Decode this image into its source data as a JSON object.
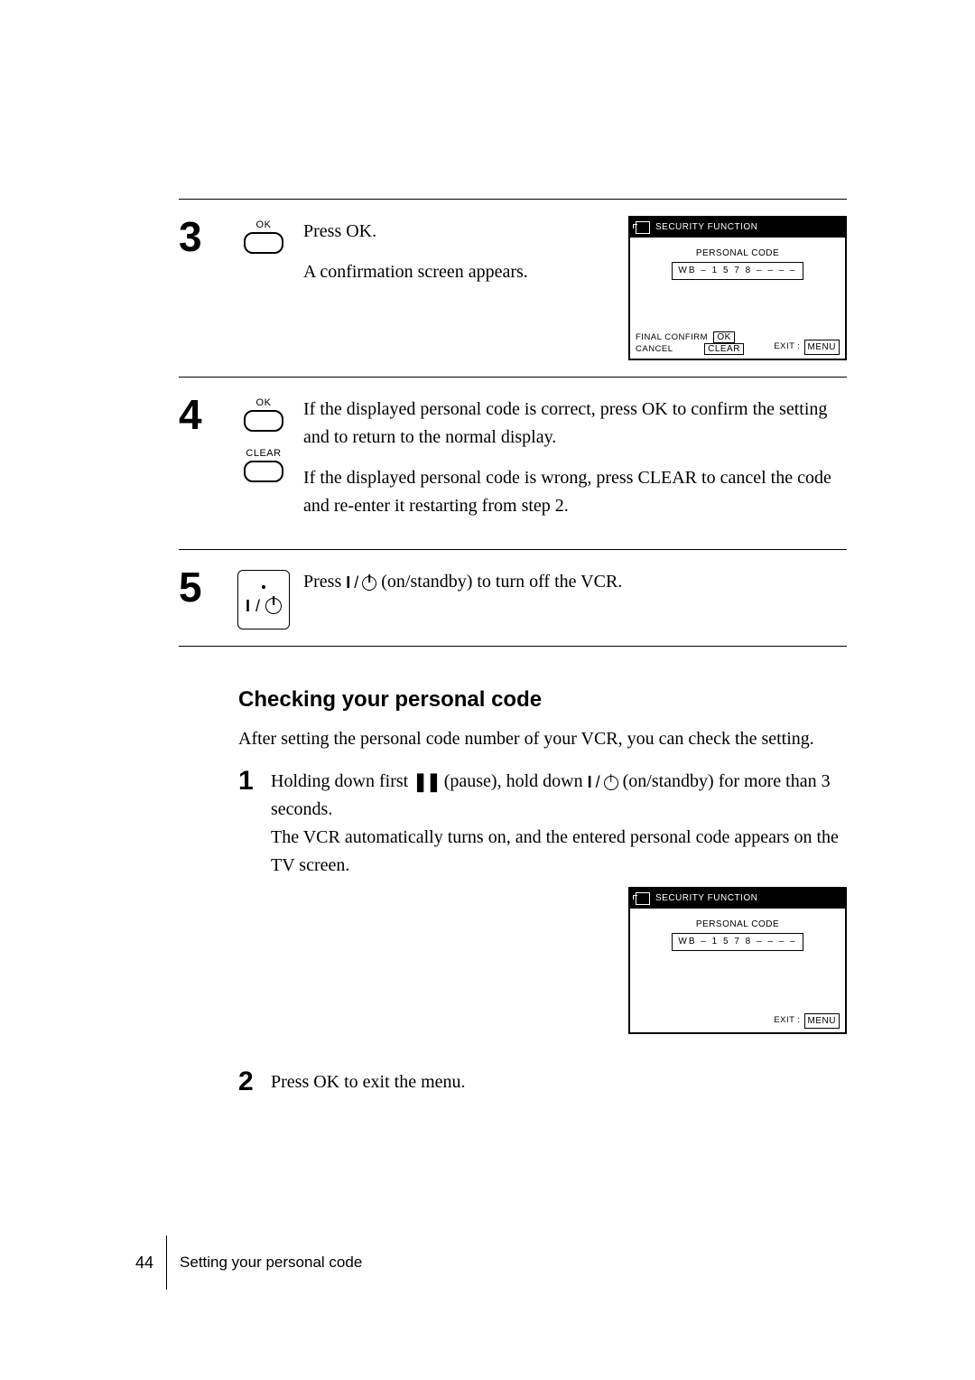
{
  "step3": {
    "num": "3",
    "btn_label": "OK",
    "line1": "Press OK.",
    "line2": "A confirmation screen appears."
  },
  "step4": {
    "num": "4",
    "btn1_label": "OK",
    "btn2_label": "CLEAR",
    "para1": "If the displayed personal code is correct, press OK to confirm the setting and to return to the normal display.",
    "para2": "If the displayed personal code is wrong, press CLEAR to cancel the code and re-enter it restarting from step 2."
  },
  "step5": {
    "num": "5",
    "text_before": "Press  ",
    "text_after": " (on/standby) to turn off the VCR."
  },
  "osd": {
    "title": "SECURITY FUNCTION",
    "code_label": "PERSONAL CODE",
    "code_value": "WB – 1 5 7 8 – – – –",
    "confirm_line1": "FINAL CONFIRM",
    "confirm_line2": "CANCEL",
    "ok_box": "OK",
    "clear_box": "CLEAR",
    "exit_label": "EXIT   :",
    "menu_box": "MENU"
  },
  "section": {
    "heading": "Checking your personal code",
    "intro": "After setting the personal code number of your VCR, you can check the setting.",
    "item1_num": "1",
    "item1_a": "Holding down first ",
    "item1_b": " (pause),  hold down ",
    "item1_c": " (on/standby) for more than 3 seconds.",
    "item1_d": "The VCR automatically turns on, and the entered personal code appears on the TV screen.",
    "item2_num": "2",
    "item2_text": "Press OK to exit the menu."
  },
  "footer": {
    "page_num": "44",
    "chapter": "Setting your personal code"
  }
}
